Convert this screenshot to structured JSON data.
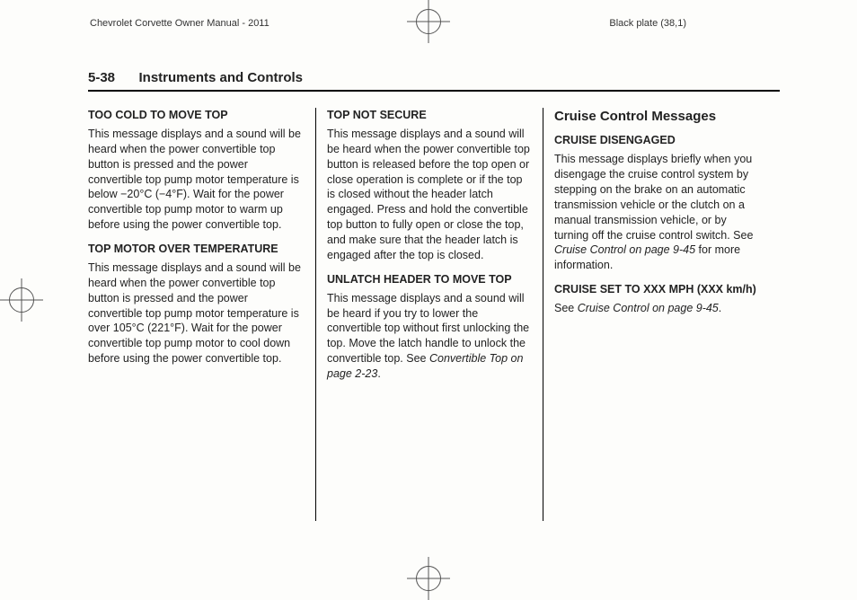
{
  "meta": {
    "manual_title": "Chevrolet Corvette Owner Manual - 2011",
    "plate": "Black plate (38,1)"
  },
  "header": {
    "page_num": "5-38",
    "section": "Instruments and Controls"
  },
  "col1": {
    "h1": "TOO COLD TO MOVE TOP",
    "p1": "This message displays and a sound will be heard when the power convertible top button is pressed and the power convertible top pump motor temperature is below −20°C (−4°F). Wait for the power convertible top pump motor to warm up before using the power convertible top.",
    "h2": "TOP MOTOR OVER TEMPERATURE",
    "p2": "This message displays and a sound will be heard when the power convertible top button is pressed and the power convertible top pump motor temperature is over 105°C (221°F). Wait for the power convertible top pump motor to cool down before using the power convertible top."
  },
  "col2": {
    "h1": "TOP NOT SECURE",
    "p1": "This message displays and a sound will be heard when the power convertible top button is released before the top open or close operation is complete or if the top is closed without the header latch engaged. Press and hold the convertible top button to fully open or close the top, and make sure that the header latch is engaged after the top is closed.",
    "h2": "UNLATCH HEADER TO MOVE TOP",
    "p2a": "This message displays and a sound will be heard if you try to lower the convertible top without first unlocking the top. Move the latch handle to unlock the convertible top. See ",
    "p2ref": "Convertible Top on page 2‑23",
    "p2b": "."
  },
  "col3": {
    "title": "Cruise Control Messages",
    "h1": "CRUISE DISENGAGED",
    "p1a": "This message displays briefly when you disengage the cruise control system by stepping on the brake on an automatic transmission vehicle or the clutch on a manual transmission vehicle, or by turning off the cruise control switch. See ",
    "p1ref": "Cruise Control on page 9‑45",
    "p1b": " for more information.",
    "h2": "CRUISE SET TO XXX MPH (XXX km/h)",
    "p2a": "See ",
    "p2ref": "Cruise Control on page 9‑45",
    "p2b": "."
  }
}
